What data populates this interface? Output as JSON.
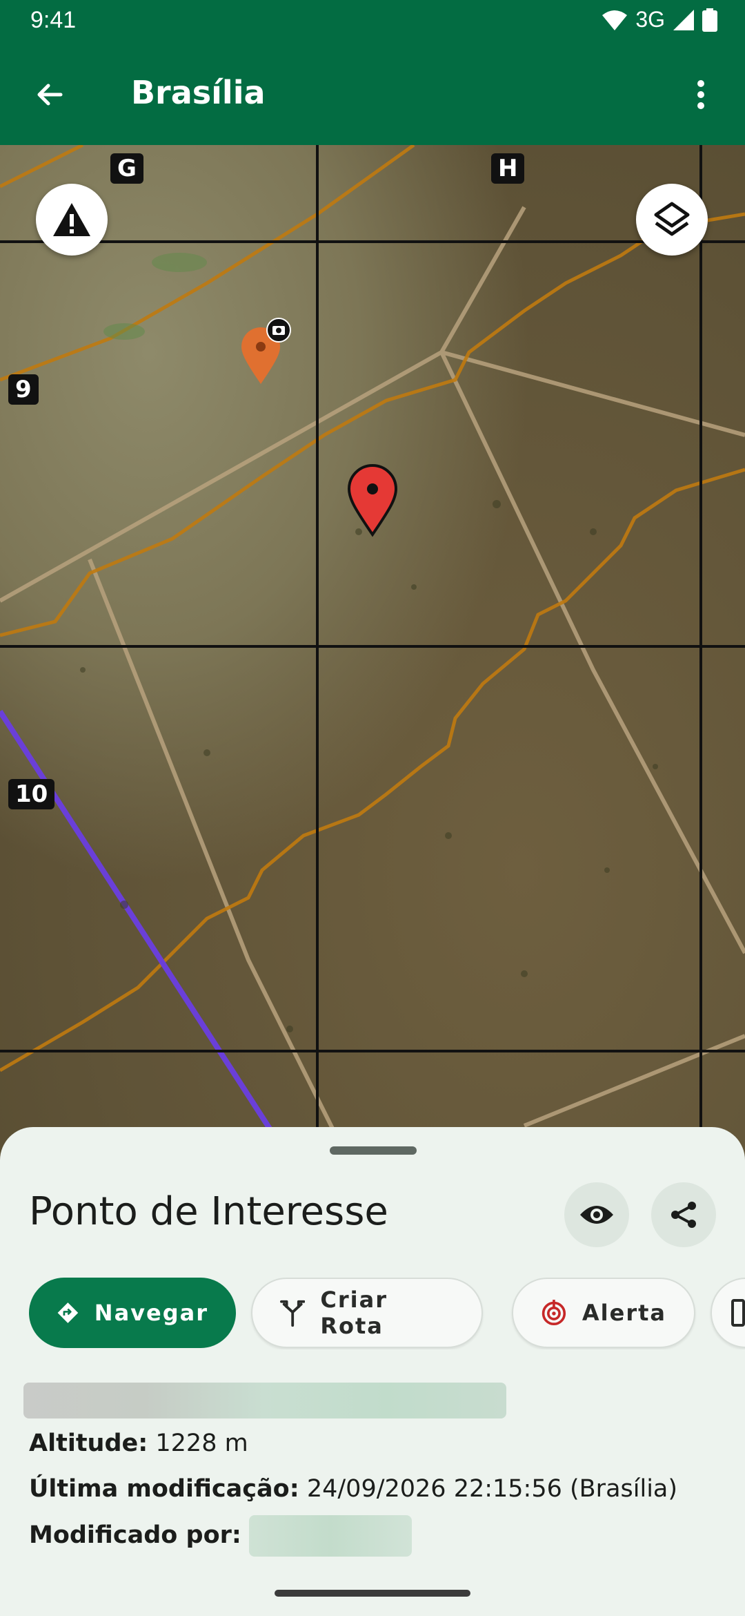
{
  "status_bar": {
    "time": "9:41",
    "network": "3G"
  },
  "app_bar": {
    "title": "Brasília",
    "back_icon": "arrow-left-icon",
    "menu_icon": "more-vert-icon"
  },
  "map": {
    "grid_labels": {
      "col_g": "G",
      "col_h": "H",
      "row_9": "9",
      "row_10": "10"
    },
    "warning_icon": "warning-icon",
    "layers_icon": "layers-icon",
    "photo_marker_icon": "camera-icon",
    "colors": {
      "grid": "#111111",
      "contour": "#c07a10",
      "route": "#6a3fd8",
      "selected_marker": "#e53935",
      "photo_marker": "#e07030"
    }
  },
  "sheet": {
    "title": "Ponto de Interesse",
    "actions": {
      "navigate": "Navegar",
      "create_route": "Criar Rota",
      "alert": "Alerta"
    },
    "info": {
      "altitude_label": "Altitude:",
      "altitude_value": "1228 m",
      "modified_label": "Última modificação:",
      "modified_value": "24/09/2026 22:15:56 (Brasília)",
      "modified_by_label": "Modificado por:"
    },
    "colors": {
      "primary": "#087a4c",
      "alert": "#c62828"
    }
  }
}
